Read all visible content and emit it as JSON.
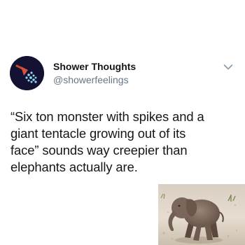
{
  "tweet": {
    "author": {
      "display_name": "Shower Thoughts",
      "handle": "@showerfeelings",
      "avatar_icon": "showerhead-icon",
      "avatar_bg": "#131233",
      "avatar_accent": "#d9533b"
    },
    "menu_icon": "chevron-down-icon",
    "text_lines": [
      "“Six ton monster with spikes and a",
      "giant tentacle growing out of its",
      "face” sounds way creepier than",
      "elephants actually are."
    ],
    "media": {
      "subject": "baby-elephant-photo"
    }
  },
  "colors": {
    "name": "#14171a",
    "secondary": "#657786",
    "background": "#ffffff"
  }
}
